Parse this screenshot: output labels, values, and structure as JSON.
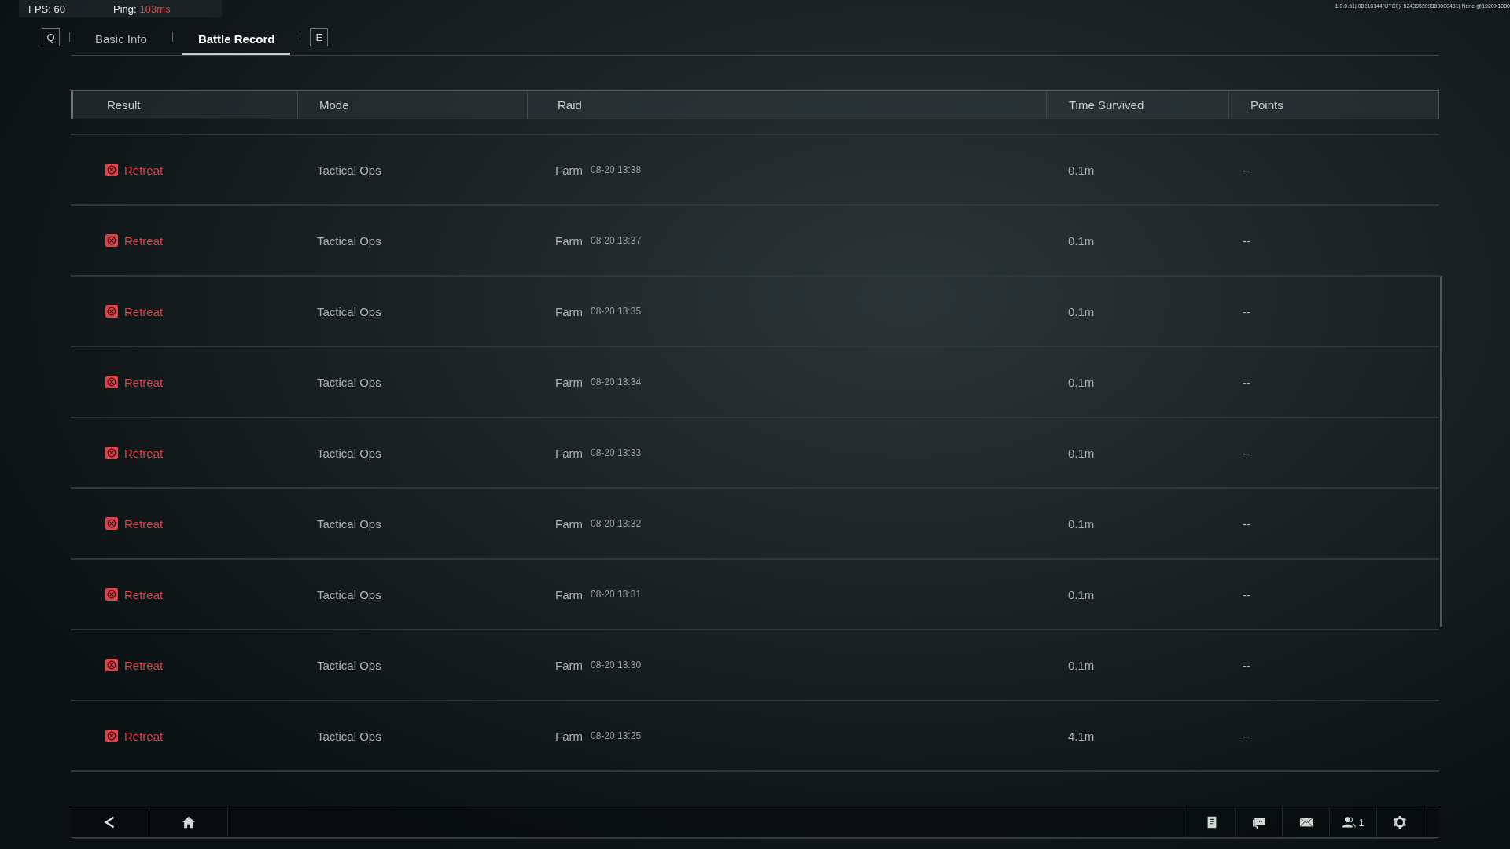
{
  "status_bar": {
    "fps_label": "FPS: 60",
    "ping_label": "Ping:",
    "ping_value": "103ms",
    "build_info": "1.0.0.61| 08210144(UTC0)| 524395209389000431| None @1920X1080"
  },
  "tabs": {
    "prev_key": "Q",
    "next_key": "E",
    "items": [
      {
        "label": "Basic Info",
        "selected": false
      },
      {
        "label": "Battle Record",
        "selected": true
      }
    ]
  },
  "table": {
    "columns": [
      "Result",
      "Mode",
      "Raid",
      "Time Survived",
      "Points"
    ],
    "rows": [
      {
        "result": "Retreat",
        "kind": "retreat",
        "mode": "Tactical Ops",
        "raid": "Farm",
        "date": "08-20 13:38",
        "time_survived": "0.1m",
        "points": "--"
      },
      {
        "result": "Retreat",
        "kind": "retreat",
        "mode": "Tactical Ops",
        "raid": "Farm",
        "date": "08-20 13:37",
        "time_survived": "0.1m",
        "points": "--"
      },
      {
        "result": "Retreat",
        "kind": "retreat",
        "mode": "Tactical Ops",
        "raid": "Farm",
        "date": "08-20 13:35",
        "time_survived": "0.1m",
        "points": "--"
      },
      {
        "result": "Retreat",
        "kind": "retreat",
        "mode": "Tactical Ops",
        "raid": "Farm",
        "date": "08-20 13:34",
        "time_survived": "0.1m",
        "points": "--"
      },
      {
        "result": "Retreat",
        "kind": "retreat",
        "mode": "Tactical Ops",
        "raid": "Farm",
        "date": "08-20 13:33",
        "time_survived": "0.1m",
        "points": "--"
      },
      {
        "result": "Retreat",
        "kind": "retreat",
        "mode": "Tactical Ops",
        "raid": "Farm",
        "date": "08-20 13:32",
        "time_survived": "0.1m",
        "points": "--"
      },
      {
        "result": "Retreat",
        "kind": "retreat",
        "mode": "Tactical Ops",
        "raid": "Farm",
        "date": "08-20 13:31",
        "time_survived": "0.1m",
        "points": "--"
      },
      {
        "result": "Retreat",
        "kind": "retreat",
        "mode": "Tactical Ops",
        "raid": "Farm",
        "date": "08-20 13:30",
        "time_survived": "0.1m",
        "points": "--"
      },
      {
        "result": "Retreat",
        "kind": "retreat",
        "mode": "Tactical Ops",
        "raid": "Farm",
        "date": "08-20 13:25",
        "time_survived": "4.1m",
        "points": "--"
      }
    ]
  },
  "bottom_bar": {
    "friends_count": "1"
  }
}
